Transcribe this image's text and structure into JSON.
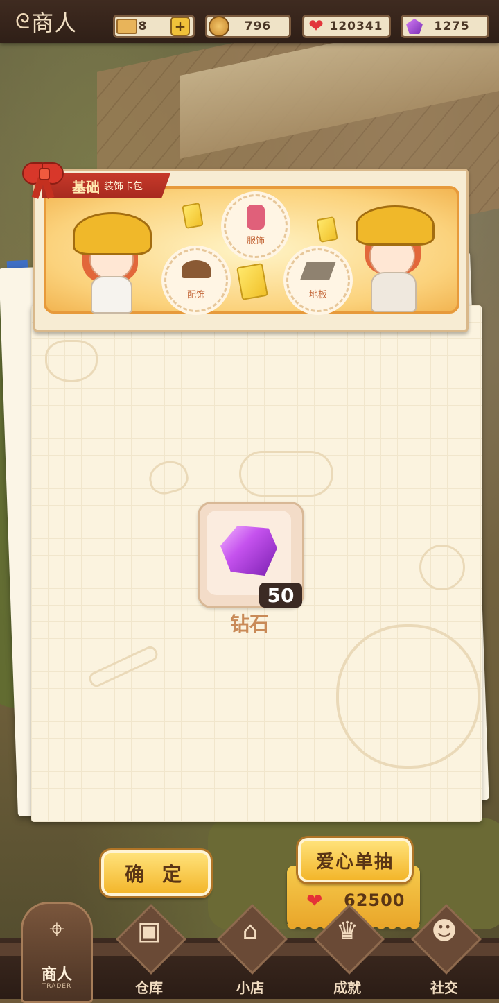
{
  "header": {
    "title": "商人"
  },
  "resources": [
    {
      "icon": "ticket-icon",
      "value": "8",
      "has_plus": true
    },
    {
      "icon": "coin-icon",
      "value": "796"
    },
    {
      "icon": "heart-icon",
      "value": "120341"
    },
    {
      "icon": "gem-icon",
      "value": "1275"
    }
  ],
  "banner": {
    "ribbon_main": "基础",
    "ribbon_sub": "装饰卡包",
    "categories": [
      "服饰",
      "配饰",
      "地板"
    ]
  },
  "reward": {
    "item_name": "钻石",
    "count": "50",
    "icon": "purple-gem-icon"
  },
  "buttons": {
    "confirm": "确 定",
    "draw": "爱心单抽",
    "cost": "62500"
  },
  "nav": {
    "active": {
      "label": "商人",
      "sub": "TRADER"
    },
    "items": [
      "仓库",
      "小店",
      "成就",
      "社交"
    ]
  },
  "colors": {
    "accent": "#f3b62b",
    "panel": "#fbf3df",
    "ribbon": "#c6392a",
    "gem": "#c552ee"
  }
}
